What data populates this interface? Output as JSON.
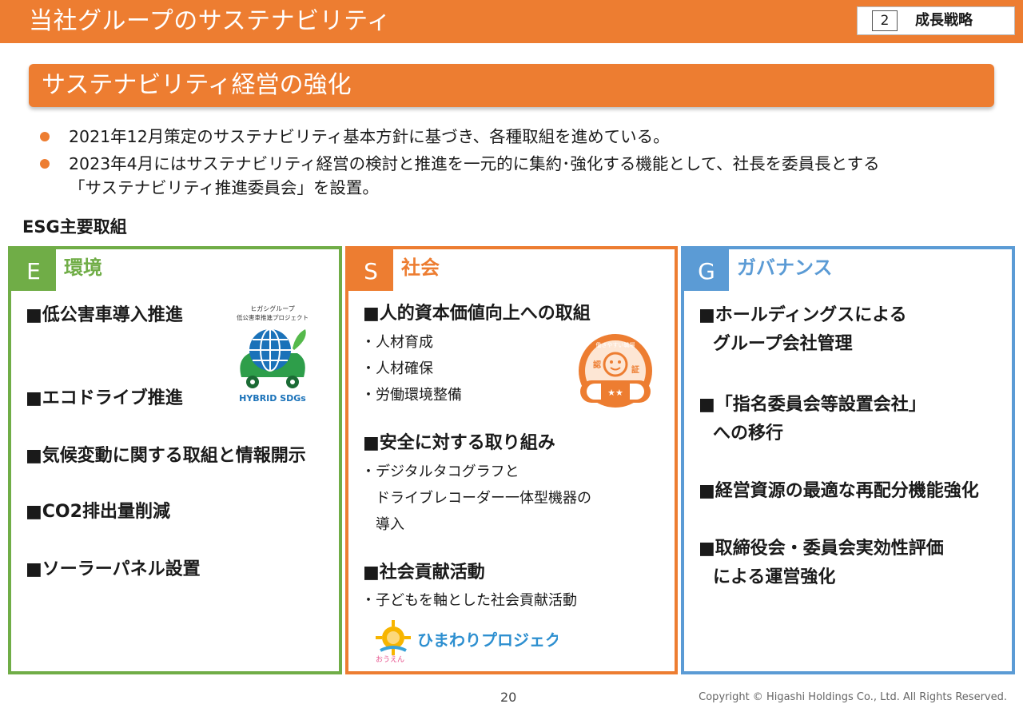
{
  "header": {
    "title": "当社グループのサステナビリティ",
    "chapter_number": "2",
    "chapter_label": "成長戦略"
  },
  "section": {
    "title": "サステナビリティ経営の強化"
  },
  "bullets": [
    "2021年12月策定のサステナビリティ基本方針に基づき、各種取組を進めている。",
    "2023年4月にはサステナビリティ経営の検討と推進を一元的に集約･強化する機能として、社長を委員長とする",
    "「サステナビリティ推進委員会」を設置。"
  ],
  "esg_title": "ESG主要取組",
  "environment": {
    "letter": "E",
    "title": "環境",
    "items": [
      "■低公害車導入推進",
      "■エコドライブ推進",
      "■気候変動に関する取組と情報開示",
      "■CO2排出量削減",
      "■ソーラーパネル設置"
    ],
    "logo": {
      "caption_line1": "ヒガシグループ",
      "caption_line2": "低公害車推進プロジェクト",
      "label": "HYBRID SDGs"
    }
  },
  "social": {
    "letter": "S",
    "title": "社会",
    "groups": [
      {
        "heading": "■人的資本価値向上への取組",
        "lines": [
          "・人材育成",
          "・人材確保",
          "・労働環境整備"
        ]
      },
      {
        "heading": "■安全に対する取り組み",
        "lines": [
          "・デジタルタコグラフと",
          "ドライブレコーダー一体型機器の",
          "導入"
        ]
      },
      {
        "heading": "■社会貢献活動",
        "lines": [
          "・子どもを軸とした社会貢献活動"
        ]
      }
    ],
    "badge": {
      "left_char": "認",
      "right_char": "証",
      "arc_text": "働きやすい職場"
    },
    "sunflower_logo": {
      "text": "ひまわりプロジェクト",
      "sub": "おうえん"
    }
  },
  "governance": {
    "letter": "G",
    "title": "ガバナンス",
    "items": [
      [
        "■ホールディングスによる",
        "グループ会社管理"
      ],
      [
        "■「指名委員会等設置会社」",
        "への移行"
      ],
      [
        "■経営資源の最適な再配分機能強化"
      ],
      [
        "■取締役会・委員会実効性評価",
        "による運営強化"
      ]
    ]
  },
  "footer": {
    "page_number": "20",
    "copyright": "Copyright © Higashi Holdings Co., Ltd. All Rights Reserved."
  },
  "colors": {
    "orange": "#ed7d31",
    "green": "#70ad47",
    "blue": "#5b9bd5"
  }
}
